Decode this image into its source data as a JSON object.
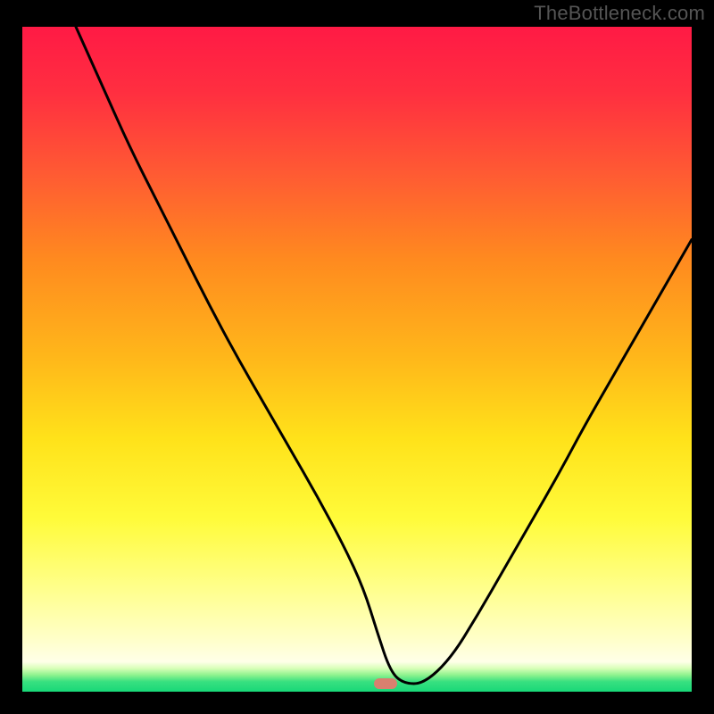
{
  "watermark": "TheBottleneck.com",
  "colors": {
    "frame": "#000000",
    "marker": "#d9806f",
    "curve": "#000000",
    "gradient_stops": [
      {
        "offset": 0.0,
        "color": "#ff1a45"
      },
      {
        "offset": 0.1,
        "color": "#ff2f40"
      },
      {
        "offset": 0.22,
        "color": "#ff5a33"
      },
      {
        "offset": 0.35,
        "color": "#ff8a1f"
      },
      {
        "offset": 0.5,
        "color": "#ffb81a"
      },
      {
        "offset": 0.62,
        "color": "#ffe21a"
      },
      {
        "offset": 0.74,
        "color": "#fffb3a"
      },
      {
        "offset": 0.84,
        "color": "#ffff88"
      },
      {
        "offset": 0.92,
        "color": "#ffffc8"
      },
      {
        "offset": 0.955,
        "color": "#ffffe8"
      },
      {
        "offset": 0.965,
        "color": "#d8ffb8"
      },
      {
        "offset": 0.975,
        "color": "#8df28e"
      },
      {
        "offset": 0.985,
        "color": "#38e080"
      },
      {
        "offset": 1.0,
        "color": "#18d878"
      }
    ]
  },
  "chart_data": {
    "type": "line",
    "title": "",
    "xlabel": "",
    "ylabel": "",
    "xlim": [
      0,
      100
    ],
    "ylim": [
      0,
      100
    ],
    "grid": false,
    "legend": false,
    "marker": {
      "x": 54.3,
      "y": 1.2
    },
    "series": [
      {
        "name": "curve",
        "x": [
          8,
          12,
          16,
          20,
          24,
          28,
          32,
          36,
          40,
          44,
          48,
          51,
          53,
          55,
          57,
          60,
          64,
          68,
          72,
          76,
          80,
          84,
          88,
          92,
          96,
          100
        ],
        "y": [
          100,
          91,
          82,
          74,
          66,
          58,
          50.5,
          43.5,
          36.5,
          29.5,
          22,
          15.5,
          9,
          3,
          1.2,
          1.2,
          5,
          11.5,
          18.5,
          25.5,
          32.5,
          40,
          47,
          54,
          61,
          68
        ]
      }
    ]
  }
}
